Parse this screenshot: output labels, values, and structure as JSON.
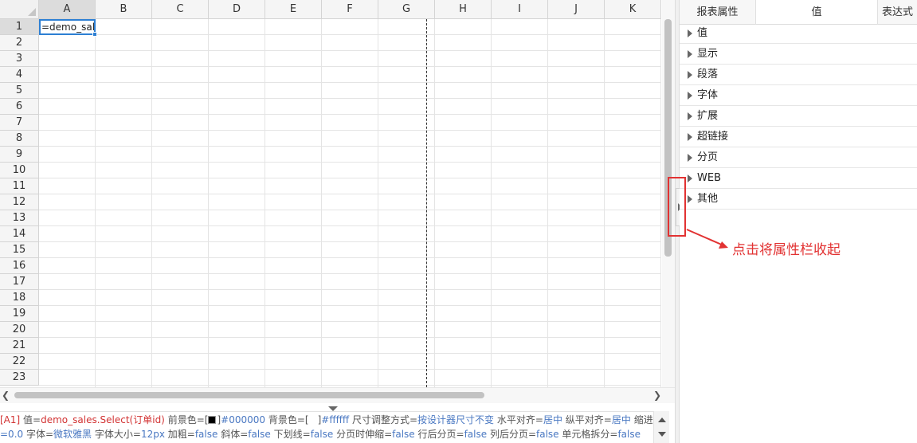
{
  "sheet": {
    "columns": [
      "A",
      "B",
      "C",
      "D",
      "E",
      "F",
      "G",
      "H",
      "I",
      "J",
      "K"
    ],
    "rows": [
      "1",
      "2",
      "3",
      "4",
      "5",
      "6",
      "7",
      "8",
      "9",
      "10",
      "11",
      "12",
      "13",
      "14",
      "15",
      "16",
      "17",
      "18",
      "19",
      "20",
      "21",
      "22",
      "23"
    ],
    "cell_a1": "=demo_sales",
    "selected_column": "A",
    "selected_row": "1"
  },
  "status": {
    "cell_ref": "[A1]",
    "value_key": "值=",
    "value_val": "demo_sales.Select(订单id)",
    "fg_key": "前景色=[",
    "fg_close": "]",
    "fg_val": "#000000",
    "bg_key": "背景色=[",
    "bg_close": "]",
    "bg_val": "#ffffff",
    "size_key": "尺寸调整方式=",
    "size_val": "按设计器尺寸不变",
    "halign_key": "水平对齐=",
    "halign_val": "居中",
    "valign_key": "纵平对齐=",
    "valign_val": "居中",
    "indent_key": "缩进",
    "indent_val": "=0.0",
    "font_key": "字体=",
    "font_val": "微软雅黑",
    "fontsize_key": "字体大小=",
    "fontsize_val": "12px",
    "bold_key": "加粗=",
    "bold_val": "false",
    "italic_key": "斜体=",
    "italic_val": "false",
    "underline_key": "下划线=",
    "underline_val": "false",
    "shrink_key": "分页时伸缩=",
    "shrink_val": "false",
    "rowbreak_key": "行后分页=",
    "rowbreak_val": "false",
    "colbreak_key": "列后分页=",
    "colbreak_val": "false",
    "split_key": "单元格拆分=",
    "split_val": "false",
    "fg_color": "#000000",
    "bg_color": "#ffffff"
  },
  "panel": {
    "tabs": [
      "报表属性",
      "值",
      "表达式"
    ],
    "items": [
      "值",
      "显示",
      "段落",
      "字体",
      "扩展",
      "超链接",
      "分页",
      "WEB",
      "其他"
    ]
  },
  "annotation": {
    "text": "点击将属性栏收起",
    "color": "#e23232"
  }
}
